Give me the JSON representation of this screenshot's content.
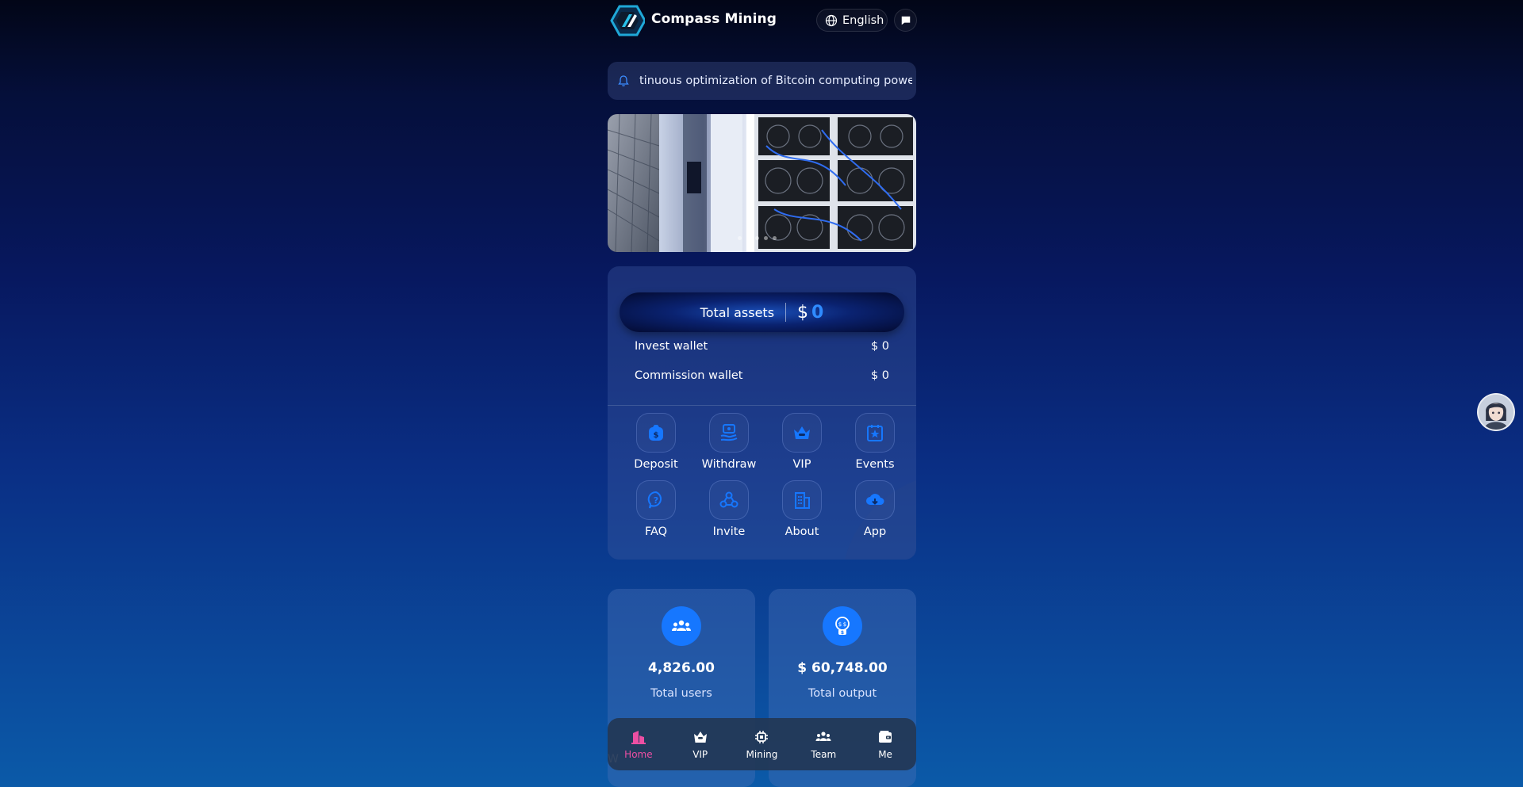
{
  "header": {
    "brand": "Compass Mining",
    "language": "English"
  },
  "notice": {
    "text": "tinuous optimization of Bitcoin computing power, re"
  },
  "banner": {
    "slides": 5,
    "active_slide": 2
  },
  "assets": {
    "total_label": "Total assets",
    "currency": "$",
    "total_value": "0",
    "invest_label": "Invest wallet",
    "invest_value": "$ 0",
    "commission_label": "Commission wallet",
    "commission_value": "$ 0"
  },
  "menu": [
    {
      "label": "Deposit",
      "icon": "deposit-icon"
    },
    {
      "label": "Withdraw",
      "icon": "withdraw-icon"
    },
    {
      "label": "VIP",
      "icon": "crown-icon"
    },
    {
      "label": "Events",
      "icon": "events-icon"
    },
    {
      "label": "FAQ",
      "icon": "faq-icon"
    },
    {
      "label": "Invite",
      "icon": "invite-icon"
    },
    {
      "label": "About",
      "icon": "building-icon"
    },
    {
      "label": "App",
      "icon": "cloud-download-icon"
    }
  ],
  "stats": {
    "users_value": "4,826.00",
    "users_label": "Total users",
    "output_value": "$ 60,748.00",
    "output_label": "Total output"
  },
  "nav": [
    {
      "label": "Home",
      "icon": "home-icon",
      "active": true
    },
    {
      "label": "VIP",
      "icon": "crown-icon"
    },
    {
      "label": "Mining",
      "icon": "chip-icon"
    },
    {
      "label": "Team",
      "icon": "team-icon"
    },
    {
      "label": "Me",
      "icon": "wallet-icon"
    }
  ],
  "peek_text": "W",
  "colors": {
    "accent": "#1677ff",
    "active_nav": "#ec4fa3",
    "total_value": "#2f8bff"
  }
}
